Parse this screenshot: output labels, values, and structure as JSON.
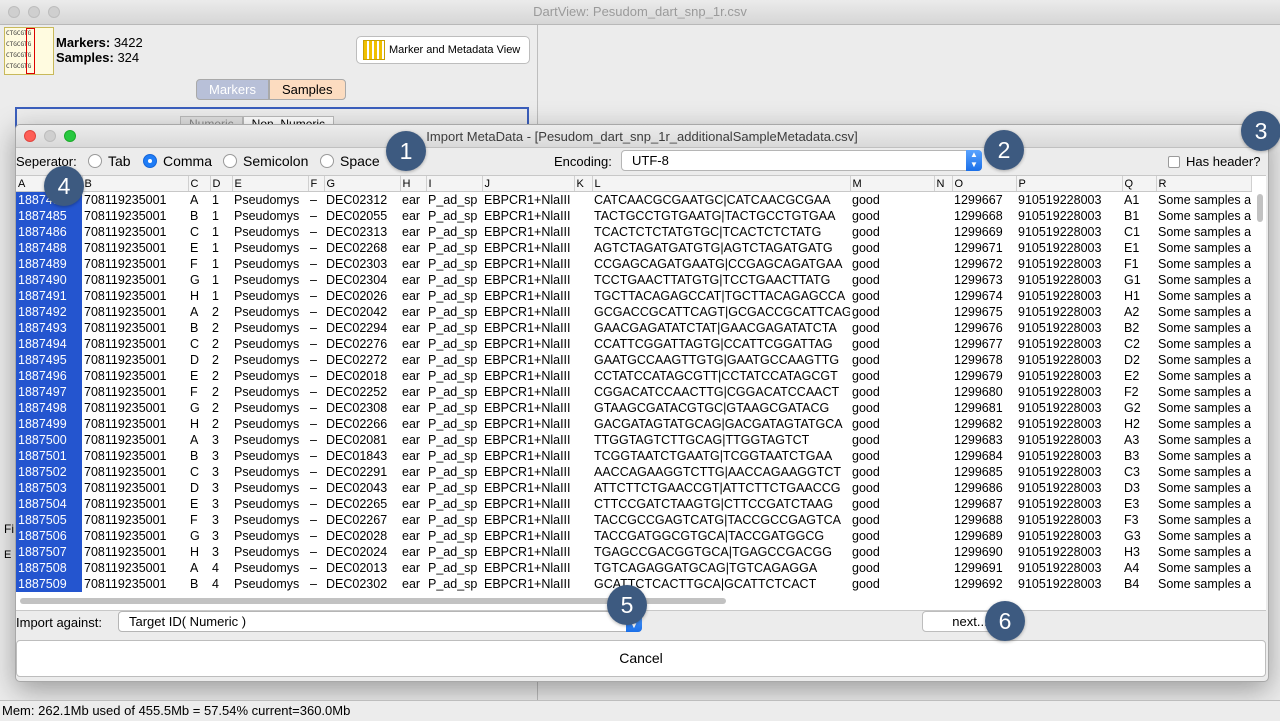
{
  "window": {
    "title": "DartView: Pesudom_dart_snp_1r.csv"
  },
  "main": {
    "markers_label": "Markers:",
    "markers_count": "3422",
    "samples_label": "Samples:",
    "samples_count": "324",
    "view_button": "Marker and Metadata View",
    "tabs": [
      "Markers",
      "Samples"
    ],
    "subtab_active": "Non_Numeric",
    "subtab_inactive": "Numeric",
    "side_frag_1": "Fi",
    "side_frag_2": "E"
  },
  "dialog": {
    "title": "Import MetaData - [Pesudom_dart_snp_1r_additionalSampleMetadata.csv]",
    "separator_label": "Seperator:",
    "separators": [
      "Tab",
      "Comma",
      "Semicolon",
      "Space"
    ],
    "selected_separator": "Comma",
    "encoding_label": "Encoding:",
    "encoding_value": "UTF-8",
    "has_header_label": "Has header?",
    "import_against_label": "Import against:",
    "import_against_value": "Target ID( Numeric )",
    "next_button": "next...",
    "cancel_button": "Cancel"
  },
  "table": {
    "columns": [
      "A",
      "B",
      "C",
      "D",
      "E",
      "F",
      "G",
      "H",
      "I",
      "J",
      "K",
      "L",
      "M",
      "N",
      "O",
      "P",
      "Q",
      "R"
    ],
    "rows": [
      [
        "1887484",
        "708119235001",
        "A",
        "1",
        "Pseudomys",
        "–",
        "DEC02312",
        "ear",
        "P_ad_sp",
        "EBPCR1+NlaIII",
        "",
        "CATCAACGCGAATGC|CATCAACGCGAA",
        "good",
        "",
        "1299667",
        "910519228003",
        "A1",
        "Some samples ar"
      ],
      [
        "1887485",
        "708119235001",
        "B",
        "1",
        "Pseudomys",
        "–",
        "DEC02055",
        "ear",
        "P_ad_sp",
        "EBPCR1+NlaIII",
        "",
        "TACTGCCTGTGAATG|TACTGCCTGTGAA",
        "good",
        "",
        "1299668",
        "910519228003",
        "B1",
        "Some samples ar"
      ],
      [
        "1887486",
        "708119235001",
        "C",
        "1",
        "Pseudomys",
        "–",
        "DEC02313",
        "ear",
        "P_ad_sp",
        "EBPCR1+NlaIII",
        "",
        "TCACTCTCTATGTGC|TCACTCTCTATG",
        "good",
        "",
        "1299669",
        "910519228003",
        "C1",
        "Some samples ar"
      ],
      [
        "1887488",
        "708119235001",
        "E",
        "1",
        "Pseudomys",
        "–",
        "DEC02268",
        "ear",
        "P_ad_sp",
        "EBPCR1+NlaIII",
        "",
        "AGTCTAGATGATGTG|AGTCTAGATGATG",
        "good",
        "",
        "1299671",
        "910519228003",
        "E1",
        "Some samples ar"
      ],
      [
        "1887489",
        "708119235001",
        "F",
        "1",
        "Pseudomys",
        "–",
        "DEC02303",
        "ear",
        "P_ad_sp",
        "EBPCR1+NlaIII",
        "",
        "CCGAGCAGATGAATG|CCGAGCAGATGAA",
        "good",
        "",
        "1299672",
        "910519228003",
        "F1",
        "Some samples ar"
      ],
      [
        "1887490",
        "708119235001",
        "G",
        "1",
        "Pseudomys",
        "–",
        "DEC02304",
        "ear",
        "P_ad_sp",
        "EBPCR1+NlaIII",
        "",
        "TCCTGAACTTATGTG|TCCTGAACTTATG",
        "good",
        "",
        "1299673",
        "910519228003",
        "G1",
        "Some samples ar"
      ],
      [
        "1887491",
        "708119235001",
        "H",
        "1",
        "Pseudomys",
        "–",
        "DEC02026",
        "ear",
        "P_ad_sp",
        "EBPCR1+NlaIII",
        "",
        "TGCTTACAGAGCCAT|TGCTTACAGAGCCA",
        "good",
        "",
        "1299674",
        "910519228003",
        "H1",
        "Some samples ar"
      ],
      [
        "1887492",
        "708119235001",
        "A",
        "2",
        "Pseudomys",
        "–",
        "DEC02042",
        "ear",
        "P_ad_sp",
        "EBPCR1+NlaIII",
        "",
        "GCGACCGCATTCAGT|GCGACCGCATTCAG",
        "good",
        "",
        "1299675",
        "910519228003",
        "A2",
        "Some samples ar"
      ],
      [
        "1887493",
        "708119235001",
        "B",
        "2",
        "Pseudomys",
        "–",
        "DEC02294",
        "ear",
        "P_ad_sp",
        "EBPCR1+NlaIII",
        "",
        "GAACGAGATATCTAT|GAACGAGATATCTA",
        "good",
        "",
        "1299676",
        "910519228003",
        "B2",
        "Some samples ar"
      ],
      [
        "1887494",
        "708119235001",
        "C",
        "2",
        "Pseudomys",
        "–",
        "DEC02276",
        "ear",
        "P_ad_sp",
        "EBPCR1+NlaIII",
        "",
        "CCATTCGGATTAGTG|CCATTCGGATTAG",
        "good",
        "",
        "1299677",
        "910519228003",
        "C2",
        "Some samples ar"
      ],
      [
        "1887495",
        "708119235001",
        "D",
        "2",
        "Pseudomys",
        "–",
        "DEC02272",
        "ear",
        "P_ad_sp",
        "EBPCR1+NlaIII",
        "",
        "GAATGCCAAGTTGTG|GAATGCCAAGTTG",
        "good",
        "",
        "1299678",
        "910519228003",
        "D2",
        "Some samples ar"
      ],
      [
        "1887496",
        "708119235001",
        "E",
        "2",
        "Pseudomys",
        "–",
        "DEC02018",
        "ear",
        "P_ad_sp",
        "EBPCR1+NlaIII",
        "",
        "CCTATCCATAGCGTT|CCTATCCATAGCGT",
        "good",
        "",
        "1299679",
        "910519228003",
        "E2",
        "Some samples ar"
      ],
      [
        "1887497",
        "708119235001",
        "F",
        "2",
        "Pseudomys",
        "–",
        "DEC02252",
        "ear",
        "P_ad_sp",
        "EBPCR1+NlaIII",
        "",
        "CGGACATCCAACTTG|CGGACATCCAACT",
        "good",
        "",
        "1299680",
        "910519228003",
        "F2",
        "Some samples ar"
      ],
      [
        "1887498",
        "708119235001",
        "G",
        "2",
        "Pseudomys",
        "–",
        "DEC02308",
        "ear",
        "P_ad_sp",
        "EBPCR1+NlaIII",
        "",
        "GTAAGCGATACGTGC|GTAAGCGATACG",
        "good",
        "",
        "1299681",
        "910519228003",
        "G2",
        "Some samples ar"
      ],
      [
        "1887499",
        "708119235001",
        "H",
        "2",
        "Pseudomys",
        "–",
        "DEC02266",
        "ear",
        "P_ad_sp",
        "EBPCR1+NlaIII",
        "",
        "GACGATAGTATGCAG|GACGATAGTATGCA",
        "good",
        "",
        "1299682",
        "910519228003",
        "H2",
        "Some samples ar"
      ],
      [
        "1887500",
        "708119235001",
        "A",
        "3",
        "Pseudomys",
        "–",
        "DEC02081",
        "ear",
        "P_ad_sp",
        "EBPCR1+NlaIII",
        "",
        "TTGGTAGTCTTGCAG|TTGGTAGTCT",
        "good",
        "",
        "1299683",
        "910519228003",
        "A3",
        "Some samples ar"
      ],
      [
        "1887501",
        "708119235001",
        "B",
        "3",
        "Pseudomys",
        "–",
        "DEC01843",
        "ear",
        "P_ad_sp",
        "EBPCR1+NlaIII",
        "",
        "TCGGTAATCTGAATG|TCGGTAATCTGAA",
        "good",
        "",
        "1299684",
        "910519228003",
        "B3",
        "Some samples ar"
      ],
      [
        "1887502",
        "708119235001",
        "C",
        "3",
        "Pseudomys",
        "–",
        "DEC02291",
        "ear",
        "P_ad_sp",
        "EBPCR1+NlaIII",
        "",
        "AACCAGAAGGTCTTG|AACCAGAAGGTCT",
        "good",
        "",
        "1299685",
        "910519228003",
        "C3",
        "Some samples ar"
      ],
      [
        "1887503",
        "708119235001",
        "D",
        "3",
        "Pseudomys",
        "–",
        "DEC02043",
        "ear",
        "P_ad_sp",
        "EBPCR1+NlaIII",
        "",
        "ATTCTTCTGAACCGT|ATTCTTCTGAACCG",
        "good",
        "",
        "1299686",
        "910519228003",
        "D3",
        "Some samples ar"
      ],
      [
        "1887504",
        "708119235001",
        "E",
        "3",
        "Pseudomys",
        "–",
        "DEC02265",
        "ear",
        "P_ad_sp",
        "EBPCR1+NlaIII",
        "",
        "CTTCCGATCTAAGTG|CTTCCGATCTAAG",
        "good",
        "",
        "1299687",
        "910519228003",
        "E3",
        "Some samples ar"
      ],
      [
        "1887505",
        "708119235001",
        "F",
        "3",
        "Pseudomys",
        "–",
        "DEC02267",
        "ear",
        "P_ad_sp",
        "EBPCR1+NlaIII",
        "",
        "TACCGCCGAGTCATG|TACCGCCGAGTCA",
        "good",
        "",
        "1299688",
        "910519228003",
        "F3",
        "Some samples ar"
      ],
      [
        "1887506",
        "708119235001",
        "G",
        "3",
        "Pseudomys",
        "–",
        "DEC02028",
        "ear",
        "P_ad_sp",
        "EBPCR1+NlaIII",
        "",
        "TACCGATGGCGTGCA|TACCGATGGCG",
        "good",
        "",
        "1299689",
        "910519228003",
        "G3",
        "Some samples ar"
      ],
      [
        "1887507",
        "708119235001",
        "H",
        "3",
        "Pseudomys",
        "–",
        "DEC02024",
        "ear",
        "P_ad_sp",
        "EBPCR1+NlaIII",
        "",
        "TGAGCCGACGGTGCA|TGAGCCGACGG",
        "good",
        "",
        "1299690",
        "910519228003",
        "H3",
        "Some samples ar"
      ],
      [
        "1887508",
        "708119235001",
        "A",
        "4",
        "Pseudomys",
        "–",
        "DEC02013",
        "ear",
        "P_ad_sp",
        "EBPCR1+NlaIII",
        "",
        "TGTCAGAGGATGCAG|TGTCAGAGGA",
        "good",
        "",
        "1299691",
        "910519228003",
        "A4",
        "Some samples ar"
      ],
      [
        "1887509",
        "708119235001",
        "B",
        "4",
        "Pseudomys",
        "–",
        "DEC02302",
        "ear",
        "P_ad_sp",
        "EBPCR1+NlaIII",
        "",
        "GCATTCTCACTTGCA|GCATTCTCACT",
        "good",
        "",
        "1299692",
        "910519228003",
        "B4",
        "Some samples ar"
      ]
    ]
  },
  "badges": [
    "1",
    "2",
    "3",
    "4",
    "5",
    "6"
  ],
  "status": {
    "memory": "Mem: 262.1Mb used of 455.5Mb = 57.54% current=360.0Mb"
  },
  "colors": {
    "selection": "#2455cf",
    "badge": "#3d5a80",
    "accent": "#1f7cf6"
  }
}
